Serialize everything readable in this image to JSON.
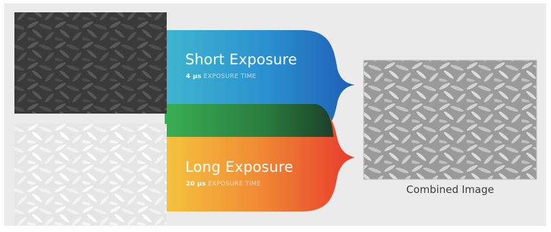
{
  "short": {
    "title": "Short Exposure",
    "value": "4 µs",
    "unit_text": "EXPOSURE TIME"
  },
  "long": {
    "title": "Long Exposure",
    "value": "20 µs",
    "unit_text": "EXPOSURE TIME"
  },
  "result": {
    "caption": "Combined Image"
  },
  "colors": {
    "background": "#ebebeb",
    "short_band_start": "#3fb6cf",
    "short_band_end": "#1f5eb5",
    "long_band_start": "#f2b63a",
    "long_band_end": "#e93a2c",
    "overlap_green": "#1e6d3a"
  }
}
